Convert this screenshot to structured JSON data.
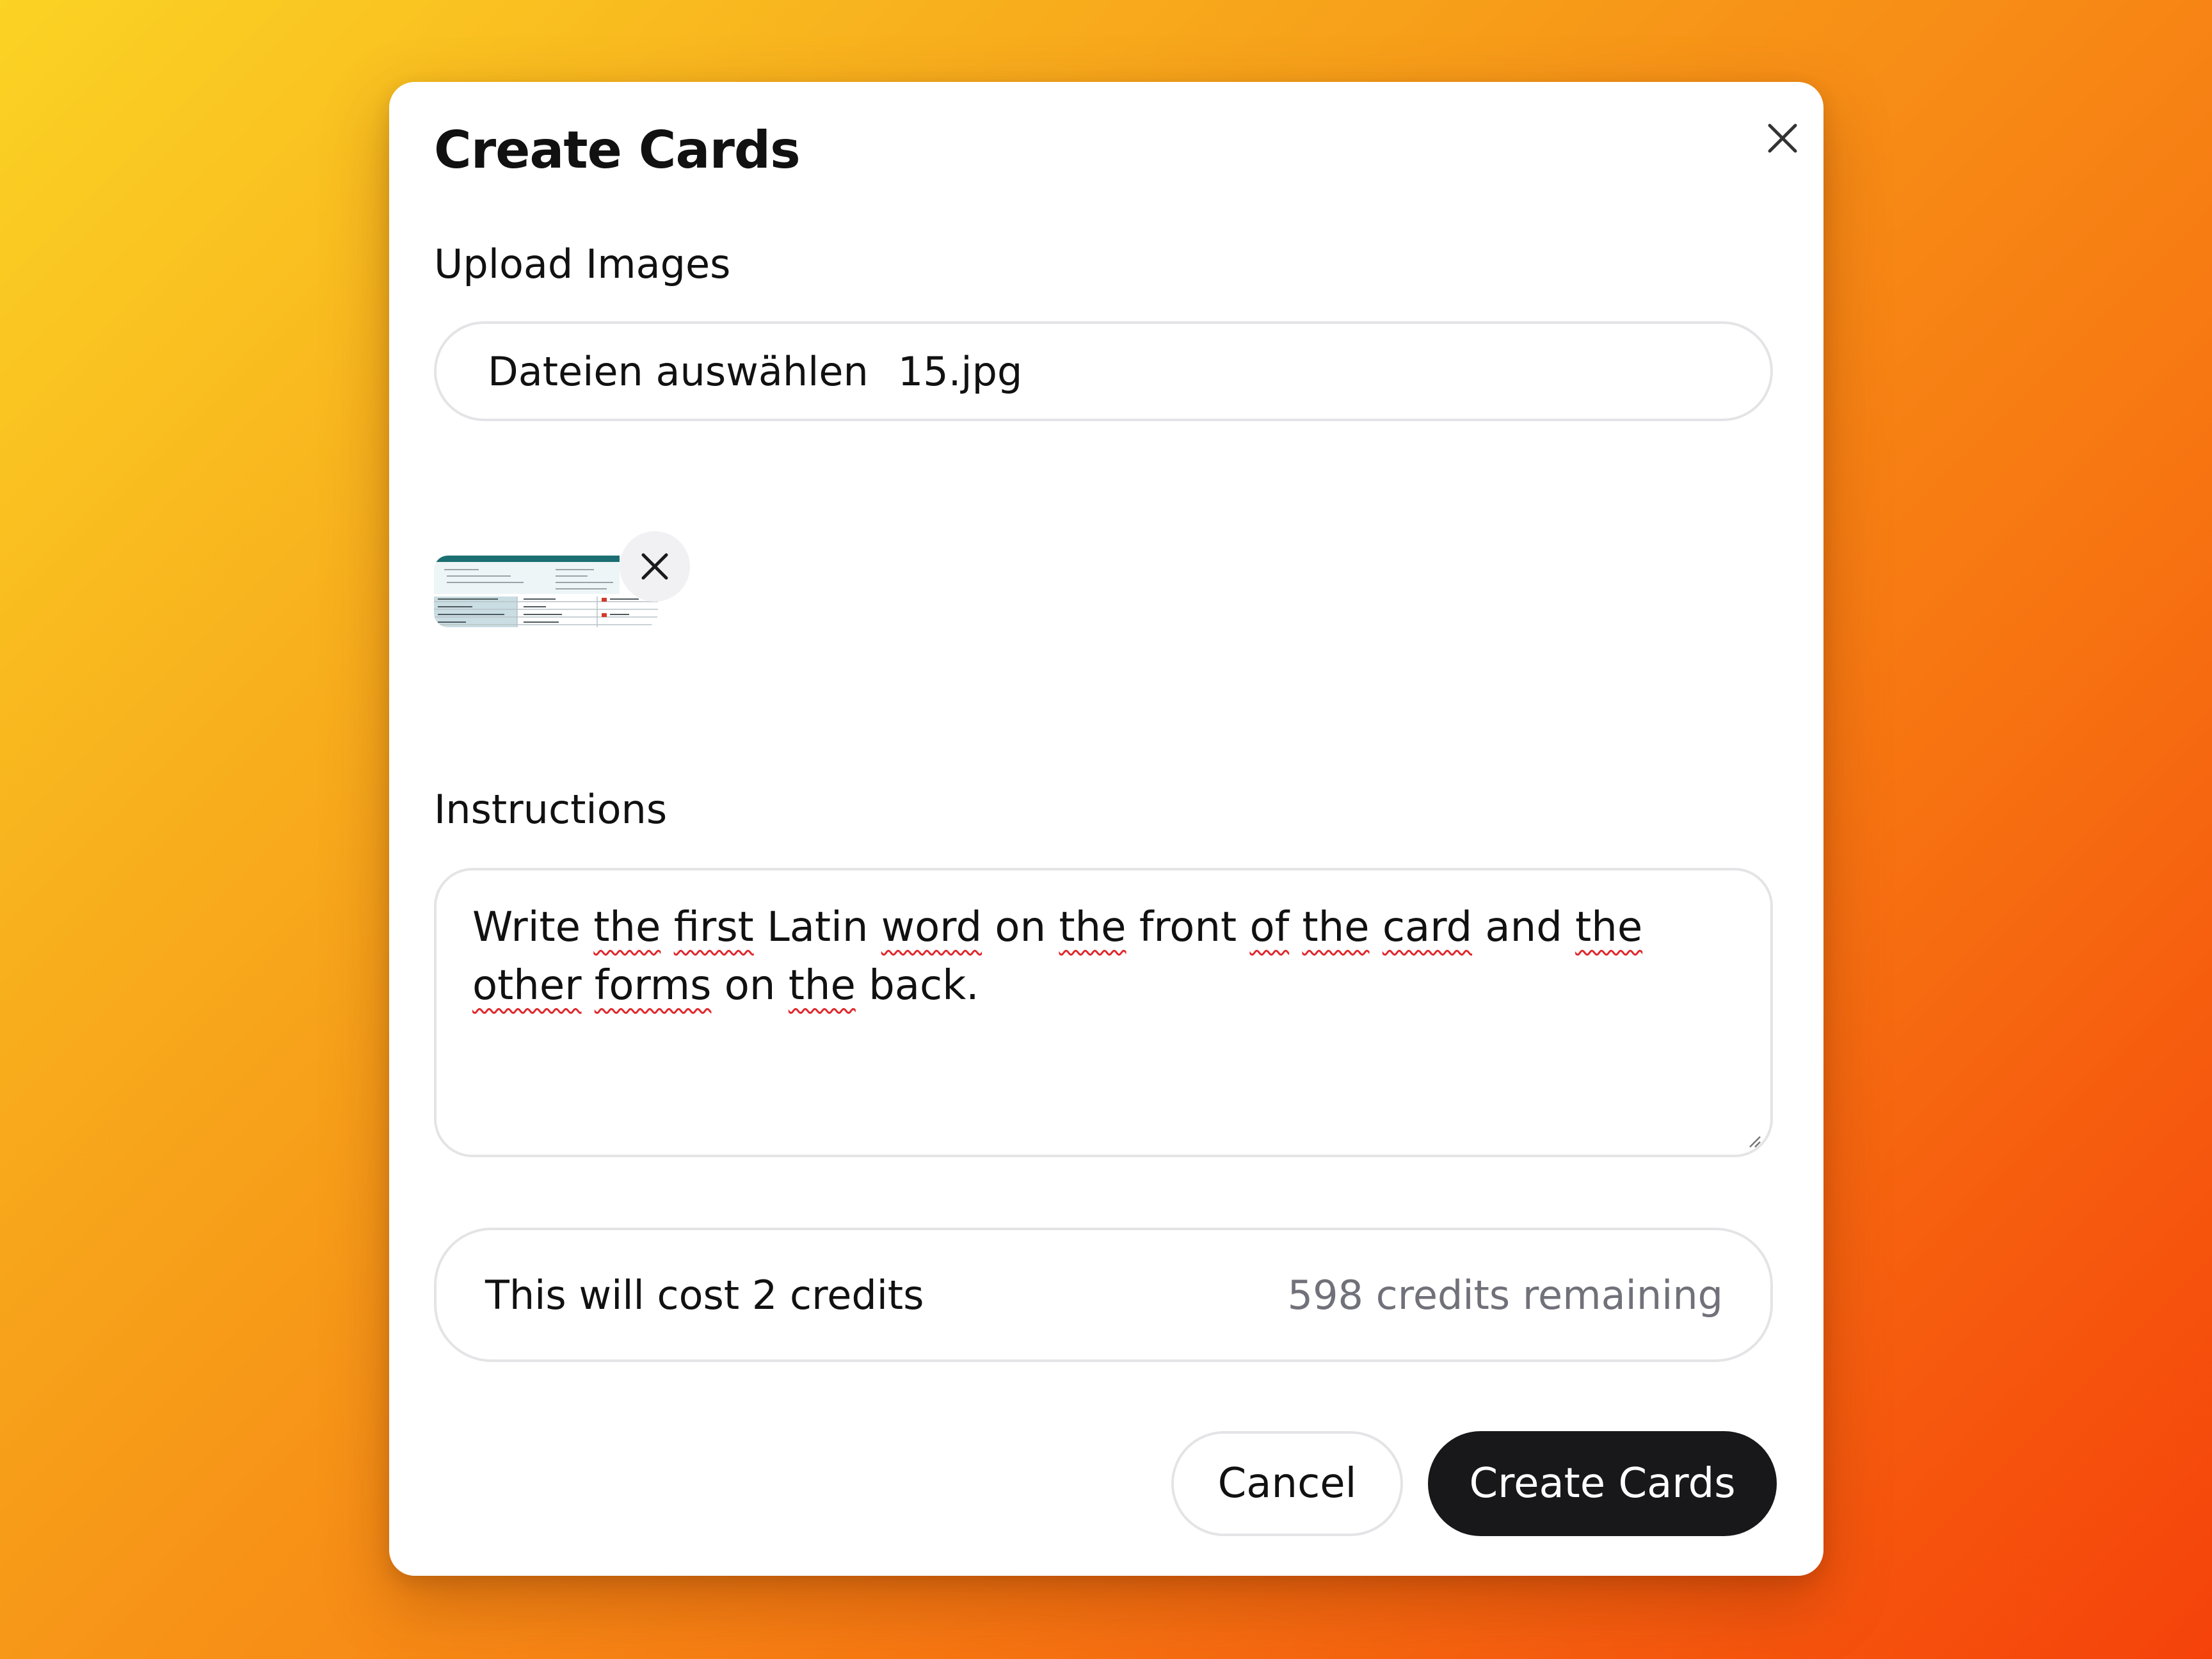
{
  "dialog": {
    "title": "Create Cards",
    "close_icon": "close-icon"
  },
  "upload": {
    "label": "Upload Images",
    "choose_label": "Dateien auswählen",
    "file_name": "15.jpg",
    "thumbnail_remove_icon": "close-icon"
  },
  "instructions": {
    "label": "Instructions",
    "value_segments": [
      {
        "text": "Write ",
        "spell": false
      },
      {
        "text": "the",
        "spell": true
      },
      {
        "text": " ",
        "spell": false
      },
      {
        "text": "first",
        "spell": true
      },
      {
        "text": " Latin ",
        "spell": false
      },
      {
        "text": "word",
        "spell": true
      },
      {
        "text": " on ",
        "spell": false
      },
      {
        "text": "the",
        "spell": true
      },
      {
        "text": " front ",
        "spell": false
      },
      {
        "text": "of",
        "spell": true
      },
      {
        "text": " ",
        "spell": false
      },
      {
        "text": "the",
        "spell": true
      },
      {
        "text": " ",
        "spell": false
      },
      {
        "text": "card",
        "spell": true
      },
      {
        "text": " and ",
        "spell": false
      },
      {
        "text": "the",
        "spell": true
      },
      {
        "text": " ",
        "spell": false
      },
      {
        "text": "other",
        "spell": true
      },
      {
        "text": " ",
        "spell": false
      },
      {
        "text": "forms",
        "spell": true
      },
      {
        "text": " on ",
        "spell": false
      },
      {
        "text": "the",
        "spell": true
      },
      {
        "text": " back.",
        "spell": false
      }
    ]
  },
  "credits": {
    "cost_text": "This will cost 2 credits",
    "remaining_text": "598 credits remaining"
  },
  "actions": {
    "cancel_label": "Cancel",
    "create_label": "Create Cards"
  },
  "colors": {
    "background_start": "#fbd324",
    "background_end": "#f5420b",
    "primary_button": "#18181b",
    "spellcheck": "#e0272b"
  }
}
